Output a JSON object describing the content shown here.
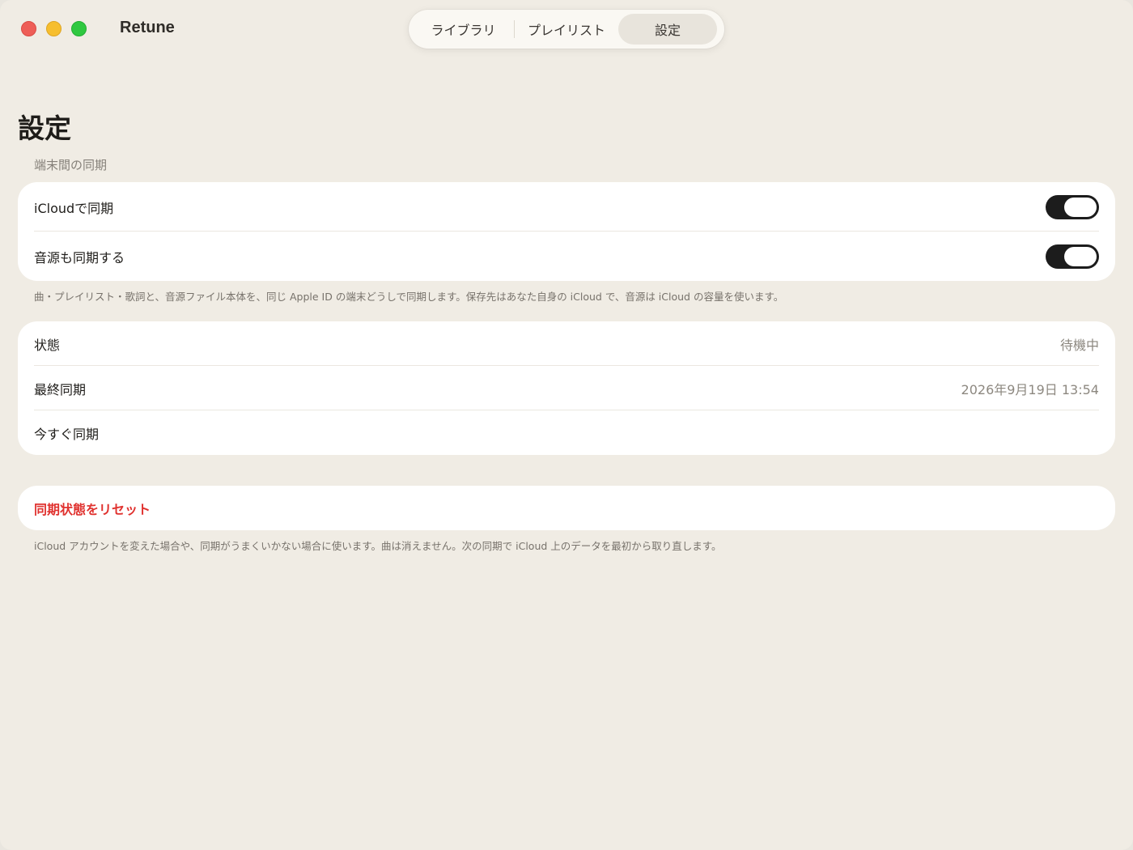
{
  "window": {
    "app_title": "Retune"
  },
  "tabs": [
    {
      "label": "ライブラリ",
      "selected": false
    },
    {
      "label": "プレイリスト",
      "selected": false
    },
    {
      "label": "設定",
      "selected": true
    }
  ],
  "page": {
    "title": "設定"
  },
  "sync_section": {
    "header": "端末間の同期",
    "rows": [
      {
        "label": "iCloudで同期",
        "toggle_on": true
      },
      {
        "label": "音源も同期する",
        "toggle_on": true
      }
    ],
    "footnote": "曲・プレイリスト・歌詞と、音源ファイル本体を、同じ Apple ID の端末どうしで同期します。保存先はあなた自身の iCloud で、音源は iCloud の容量を使います。"
  },
  "status_section": {
    "status_label": "状態",
    "status_value": "待機中",
    "last_sync_label": "最終同期",
    "last_sync_value": "2026年9月19日 13:54",
    "sync_now_label": "今すぐ同期"
  },
  "reset_section": {
    "reset_label": "同期状態をリセット",
    "footnote": "iCloud アカウントを変えた場合や、同期がうまくいかない場合に使います。曲は消えません。次の同期で iCloud 上のデータを最初から取り直します。"
  },
  "colors": {
    "background": "#f0ece4",
    "card": "#ffffff",
    "danger": "#e0322f",
    "toggle_on": "#1c1c1c"
  }
}
